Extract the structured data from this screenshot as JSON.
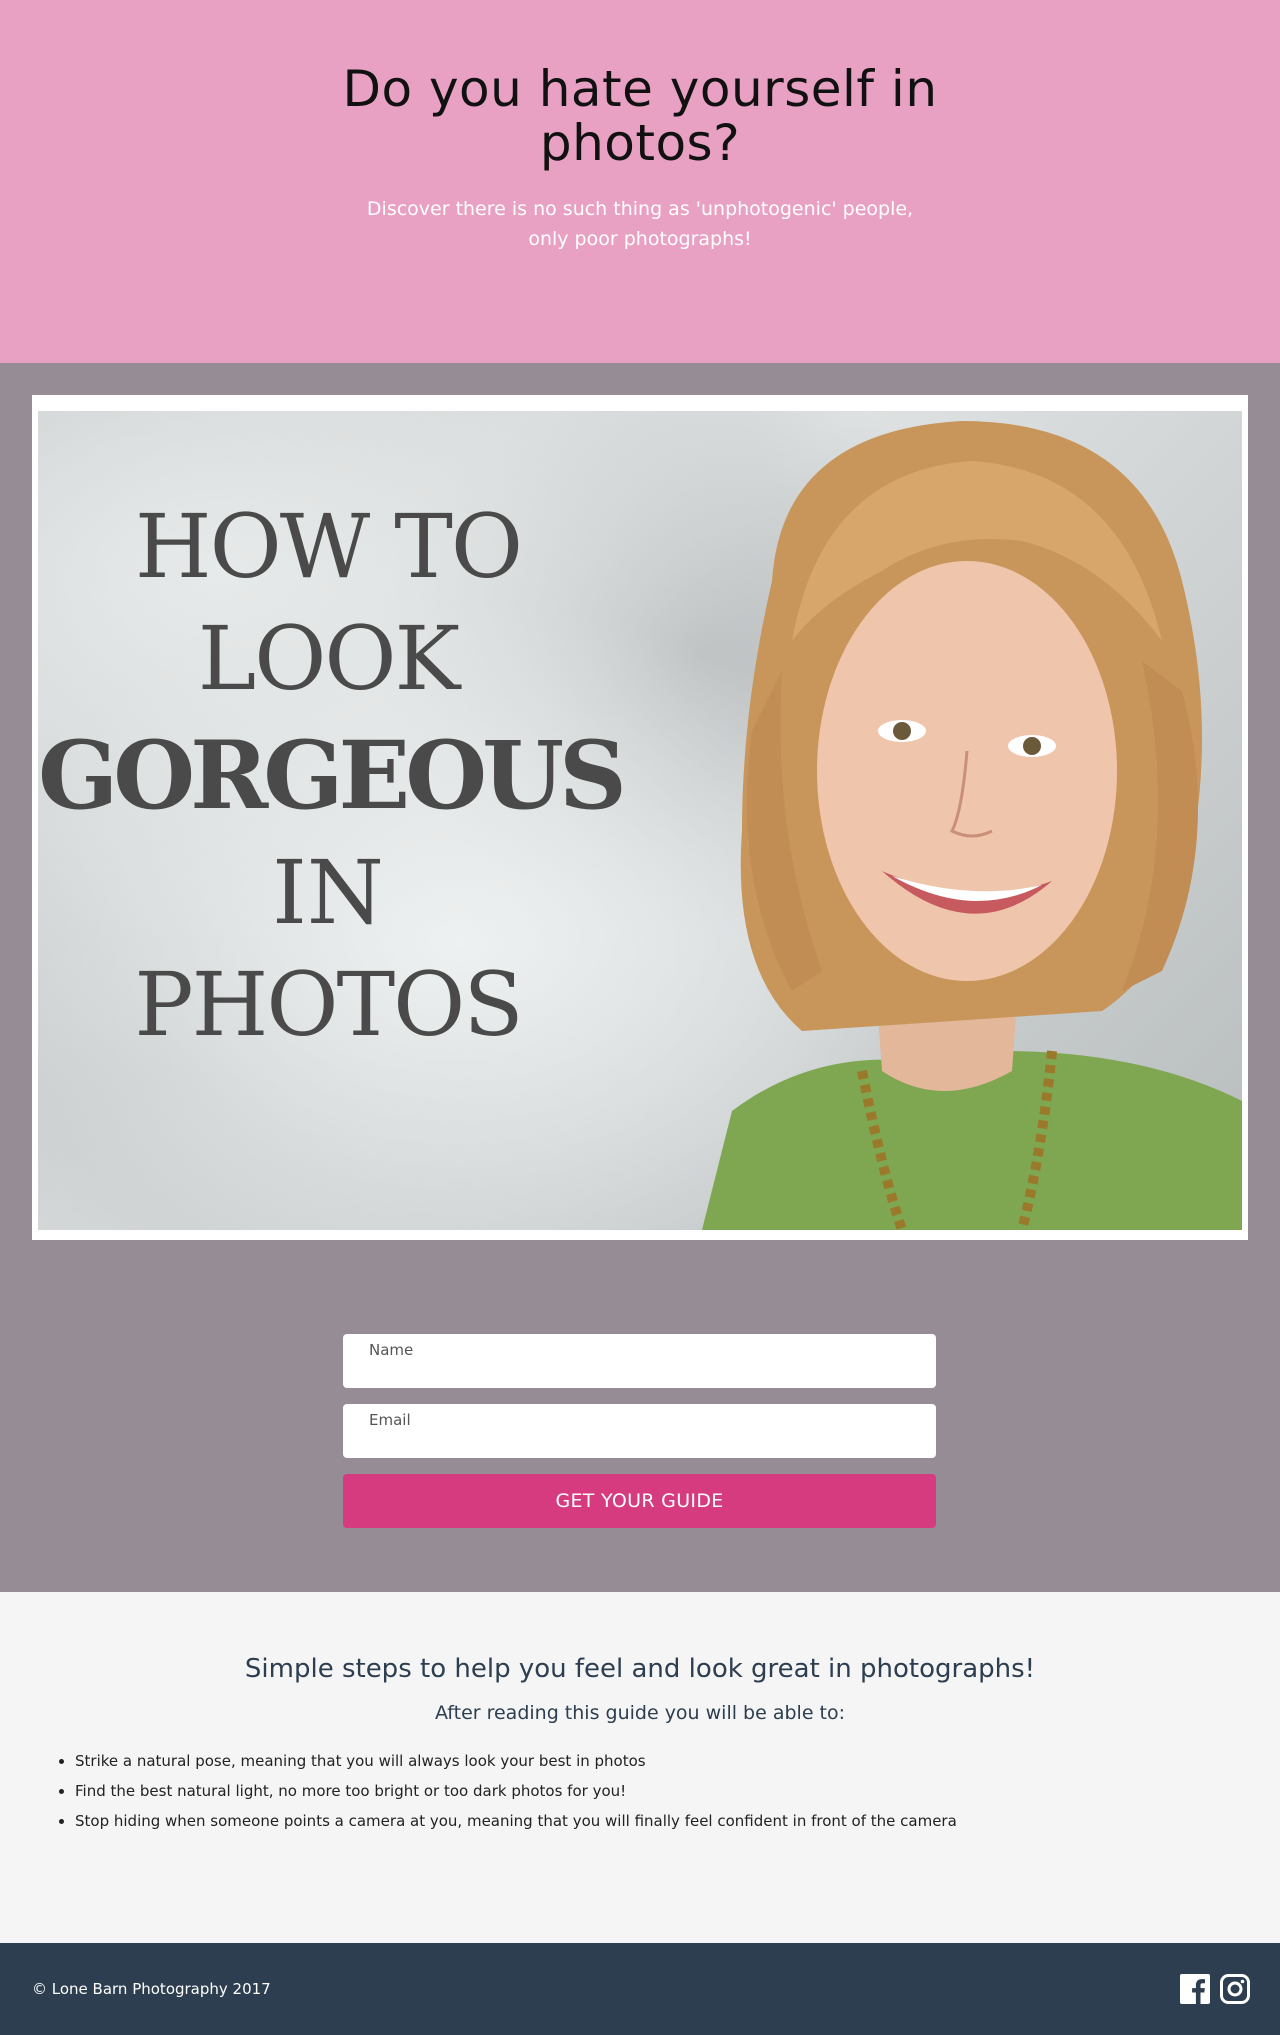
{
  "hero": {
    "title": "Do you hate yourself in photos?",
    "subtitle": "Discover there is no such thing as 'unphotogenic' people, only poor photographs!"
  },
  "promo": {
    "line1": "HOW TO",
    "line2": "LOOK",
    "line3": "GORGEOUS",
    "line4": "IN",
    "line5": "PHOTOS"
  },
  "form": {
    "name_label": "Name",
    "email_label": "Email",
    "submit_label": "GET YOUR GUIDE"
  },
  "benefits": {
    "heading": "Simple steps to help you feel and look great in photographs!",
    "subheading": "After reading this guide you will be able to:",
    "items": [
      "Strike a natural pose, meaning that you will always look your best in photos",
      "Find the best natural light, no more too bright or too dark photos for you!",
      "Stop hiding when someone points a camera at you, meaning that you will finally feel confident in front of the camera"
    ]
  },
  "footer": {
    "copyright": "© Lone Barn Photography 2017",
    "icons": [
      "facebook-icon",
      "instagram-icon"
    ]
  },
  "colors": {
    "hero_bg": "#e9a1c3",
    "section_bg": "#958c96",
    "cta": "#d63b80",
    "footer_bg": "#2c3e50"
  }
}
